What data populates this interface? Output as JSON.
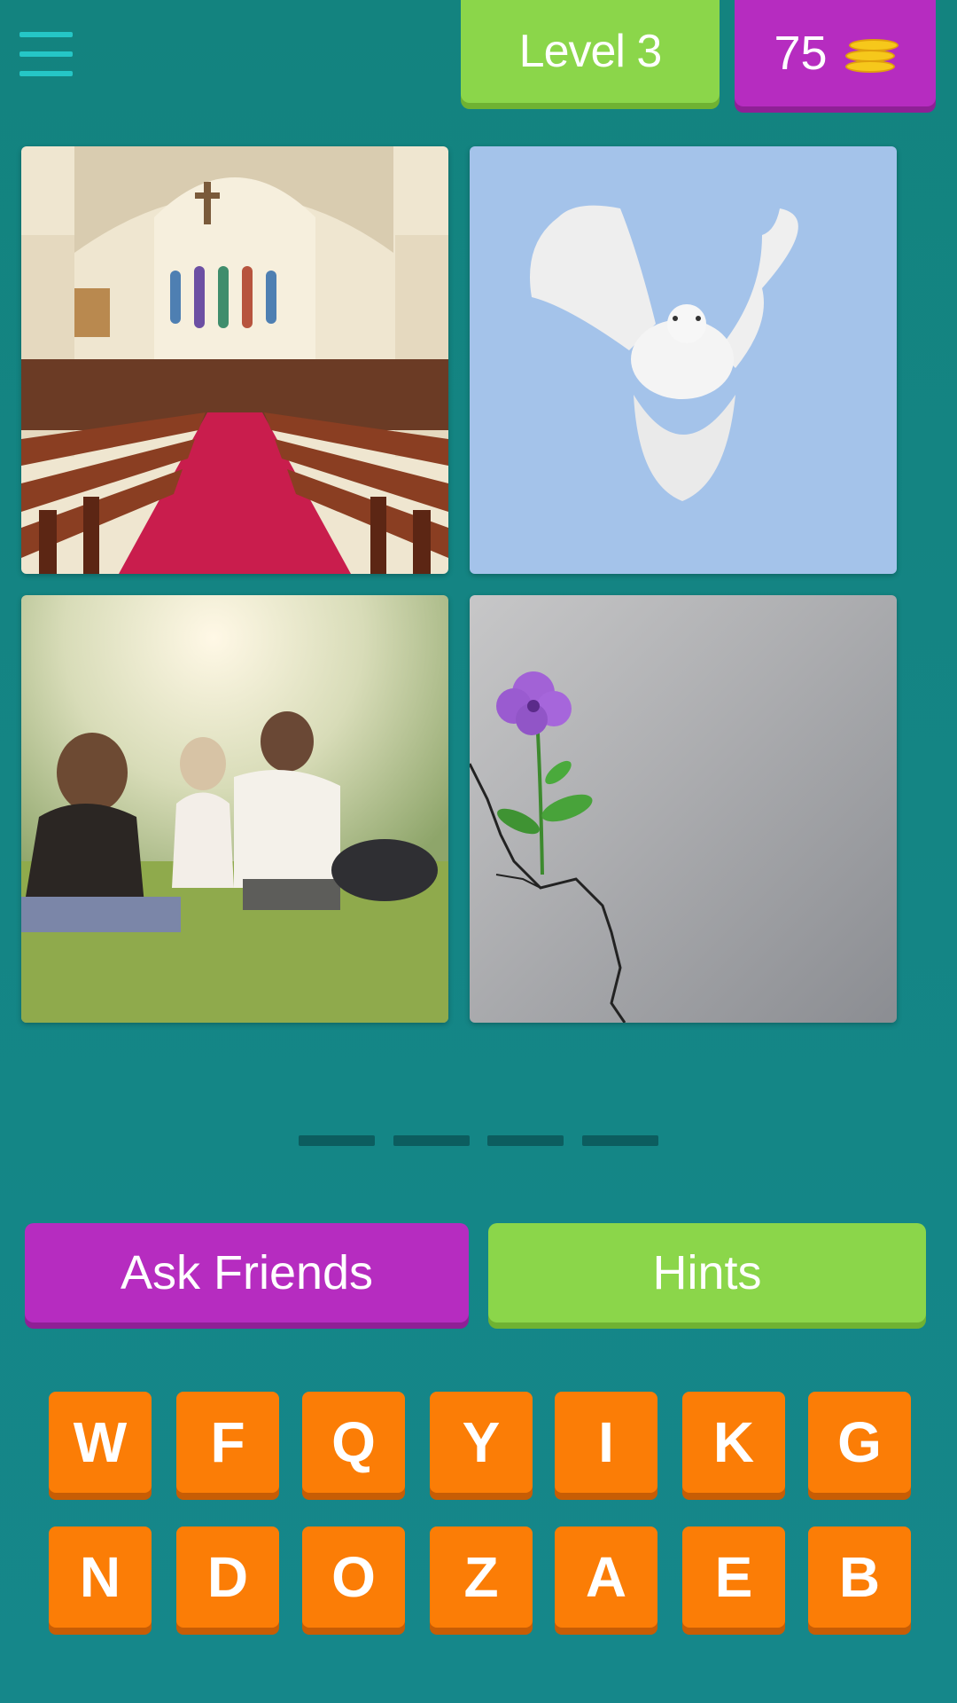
{
  "header": {
    "level_label": "Level 3",
    "coins": "75"
  },
  "photos": [
    {
      "icon": "church-interior-image"
    },
    {
      "icon": "white-dove-image"
    },
    {
      "icon": "people-sitting-in-park-image"
    },
    {
      "icon": "flower-growing-in-crack-image"
    }
  ],
  "answer": {
    "slots": [
      "",
      "",
      "",
      ""
    ]
  },
  "buttons": {
    "ask_friends": "Ask Friends",
    "hints": "Hints"
  },
  "keyboard": {
    "row1": [
      "W",
      "F",
      "Q",
      "Y",
      "I",
      "K",
      "G"
    ],
    "row2": [
      "N",
      "D",
      "O",
      "Z",
      "A",
      "E",
      "B"
    ]
  },
  "colors": {
    "background": "#13837f",
    "green": "#8bd64a",
    "purple": "#b62cc0",
    "orange": "#fb7d06",
    "coin": "#f6c81b"
  }
}
